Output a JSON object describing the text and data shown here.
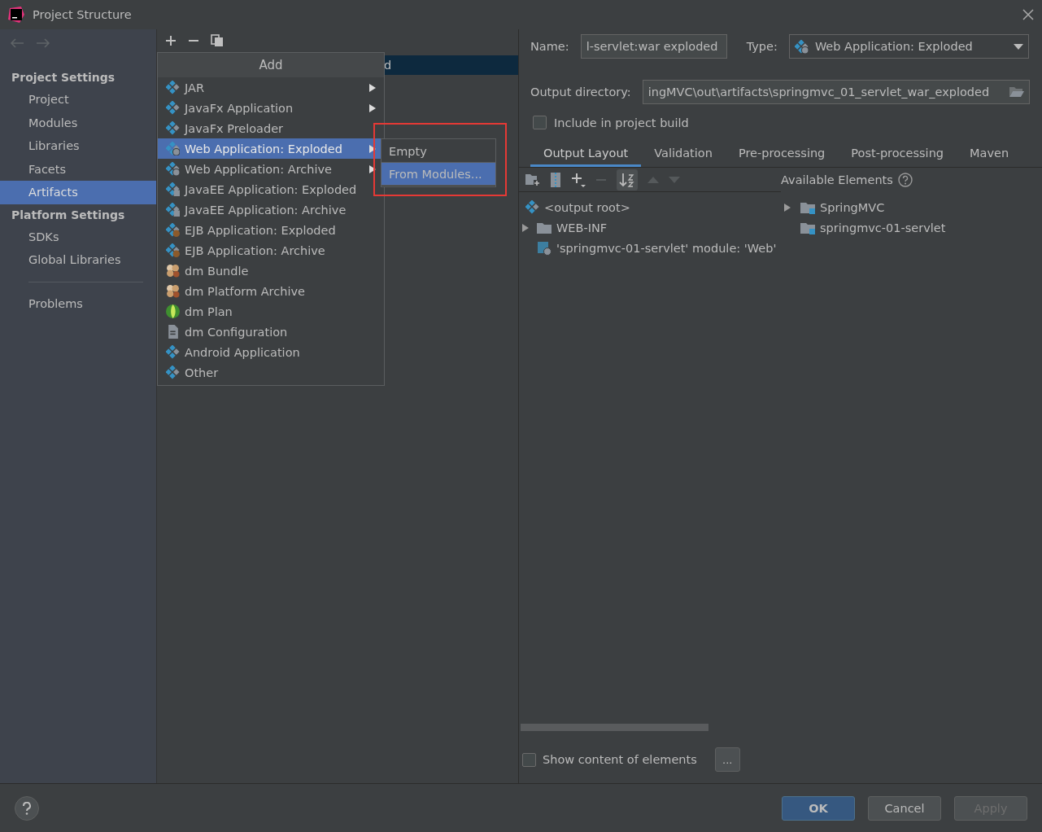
{
  "window": {
    "title": "Project Structure"
  },
  "sidebar": {
    "sections": [
      {
        "heading": "Project Settings",
        "items": [
          {
            "label": "Project",
            "selected": false
          },
          {
            "label": "Modules",
            "selected": false
          },
          {
            "label": "Libraries",
            "selected": false
          },
          {
            "label": "Facets",
            "selected": false
          },
          {
            "label": "Artifacts",
            "selected": true
          }
        ]
      },
      {
        "heading": "Platform Settings",
        "items": [
          {
            "label": "SDKs",
            "selected": false
          },
          {
            "label": "Global Libraries",
            "selected": false
          }
        ]
      }
    ],
    "extra_items": [
      {
        "label": "Problems",
        "selected": false
      }
    ]
  },
  "artifact_list": [
    {
      "label": "d",
      "selected": true
    }
  ],
  "add_menu": {
    "title": "Add",
    "items": [
      {
        "label": "JAR",
        "kind": "artifact",
        "submenu": true,
        "selected": false
      },
      {
        "label": "JavaFx Application",
        "kind": "artifact",
        "submenu": true,
        "selected": false
      },
      {
        "label": "JavaFx Preloader",
        "kind": "artifact",
        "submenu": false,
        "selected": false
      },
      {
        "label": "Web Application: Exploded",
        "kind": "web",
        "submenu": true,
        "selected": true
      },
      {
        "label": "Web Application: Archive",
        "kind": "web",
        "submenu": true,
        "selected": false
      },
      {
        "label": "JavaEE Application: Exploded",
        "kind": "javaee",
        "submenu": false,
        "selected": false
      },
      {
        "label": "JavaEE Application: Archive",
        "kind": "javaee",
        "submenu": false,
        "selected": false
      },
      {
        "label": "EJB Application: Exploded",
        "kind": "ejb",
        "submenu": false,
        "selected": false
      },
      {
        "label": "EJB Application: Archive",
        "kind": "ejb",
        "submenu": false,
        "selected": false
      },
      {
        "label": "dm Bundle",
        "kind": "bundle",
        "submenu": false,
        "selected": false
      },
      {
        "label": "dm Platform Archive",
        "kind": "bundle",
        "submenu": false,
        "selected": false
      },
      {
        "label": "dm Plan",
        "kind": "plan",
        "submenu": false,
        "selected": false
      },
      {
        "label": "dm Configuration",
        "kind": "config",
        "submenu": false,
        "selected": false
      },
      {
        "label": "Android Application",
        "kind": "artifact",
        "submenu": false,
        "selected": false
      },
      {
        "label": "Other",
        "kind": "artifact",
        "submenu": false,
        "selected": false
      }
    ]
  },
  "submenu": {
    "items": [
      {
        "label": "Empty",
        "selected": false
      },
      {
        "label": "From Modules...",
        "selected": true
      }
    ]
  },
  "form": {
    "name_label": "Name:",
    "name_value": "l-servlet:war exploded",
    "type_label": "Type:",
    "type_value": "Web Application: Exploded",
    "output_label": "Output directory:",
    "output_value": "ingMVC\\out\\artifacts\\springmvc_01_servlet_war_exploded",
    "include_label": "Include in project build",
    "include_checked": false
  },
  "tabs": [
    {
      "label": "Output Layout",
      "selected": true
    },
    {
      "label": "Validation",
      "selected": false
    },
    {
      "label": "Pre-processing",
      "selected": false
    },
    {
      "label": "Post-processing",
      "selected": false
    },
    {
      "label": "Maven",
      "selected": false
    }
  ],
  "layout_tree": [
    {
      "label": "<output root>",
      "kind": "root",
      "expandable": false
    },
    {
      "label": "WEB-INF",
      "kind": "folder",
      "expandable": true
    },
    {
      "label": "'springmvc-01-servlet' module: 'Web'",
      "kind": "module",
      "expandable": false
    }
  ],
  "available": {
    "title": "Available Elements",
    "items": [
      {
        "label": "SpringMVC",
        "expandable": true
      },
      {
        "label": "springmvc-01-servlet",
        "expandable": false
      }
    ]
  },
  "show_content": {
    "label": "Show content of elements",
    "checked": false,
    "button": "..."
  },
  "buttons": [
    {
      "label": "OK",
      "kind": "primary",
      "disabled": false
    },
    {
      "label": "Cancel",
      "kind": "normal",
      "disabled": false
    },
    {
      "label": "Apply",
      "kind": "normal",
      "disabled": true
    }
  ]
}
